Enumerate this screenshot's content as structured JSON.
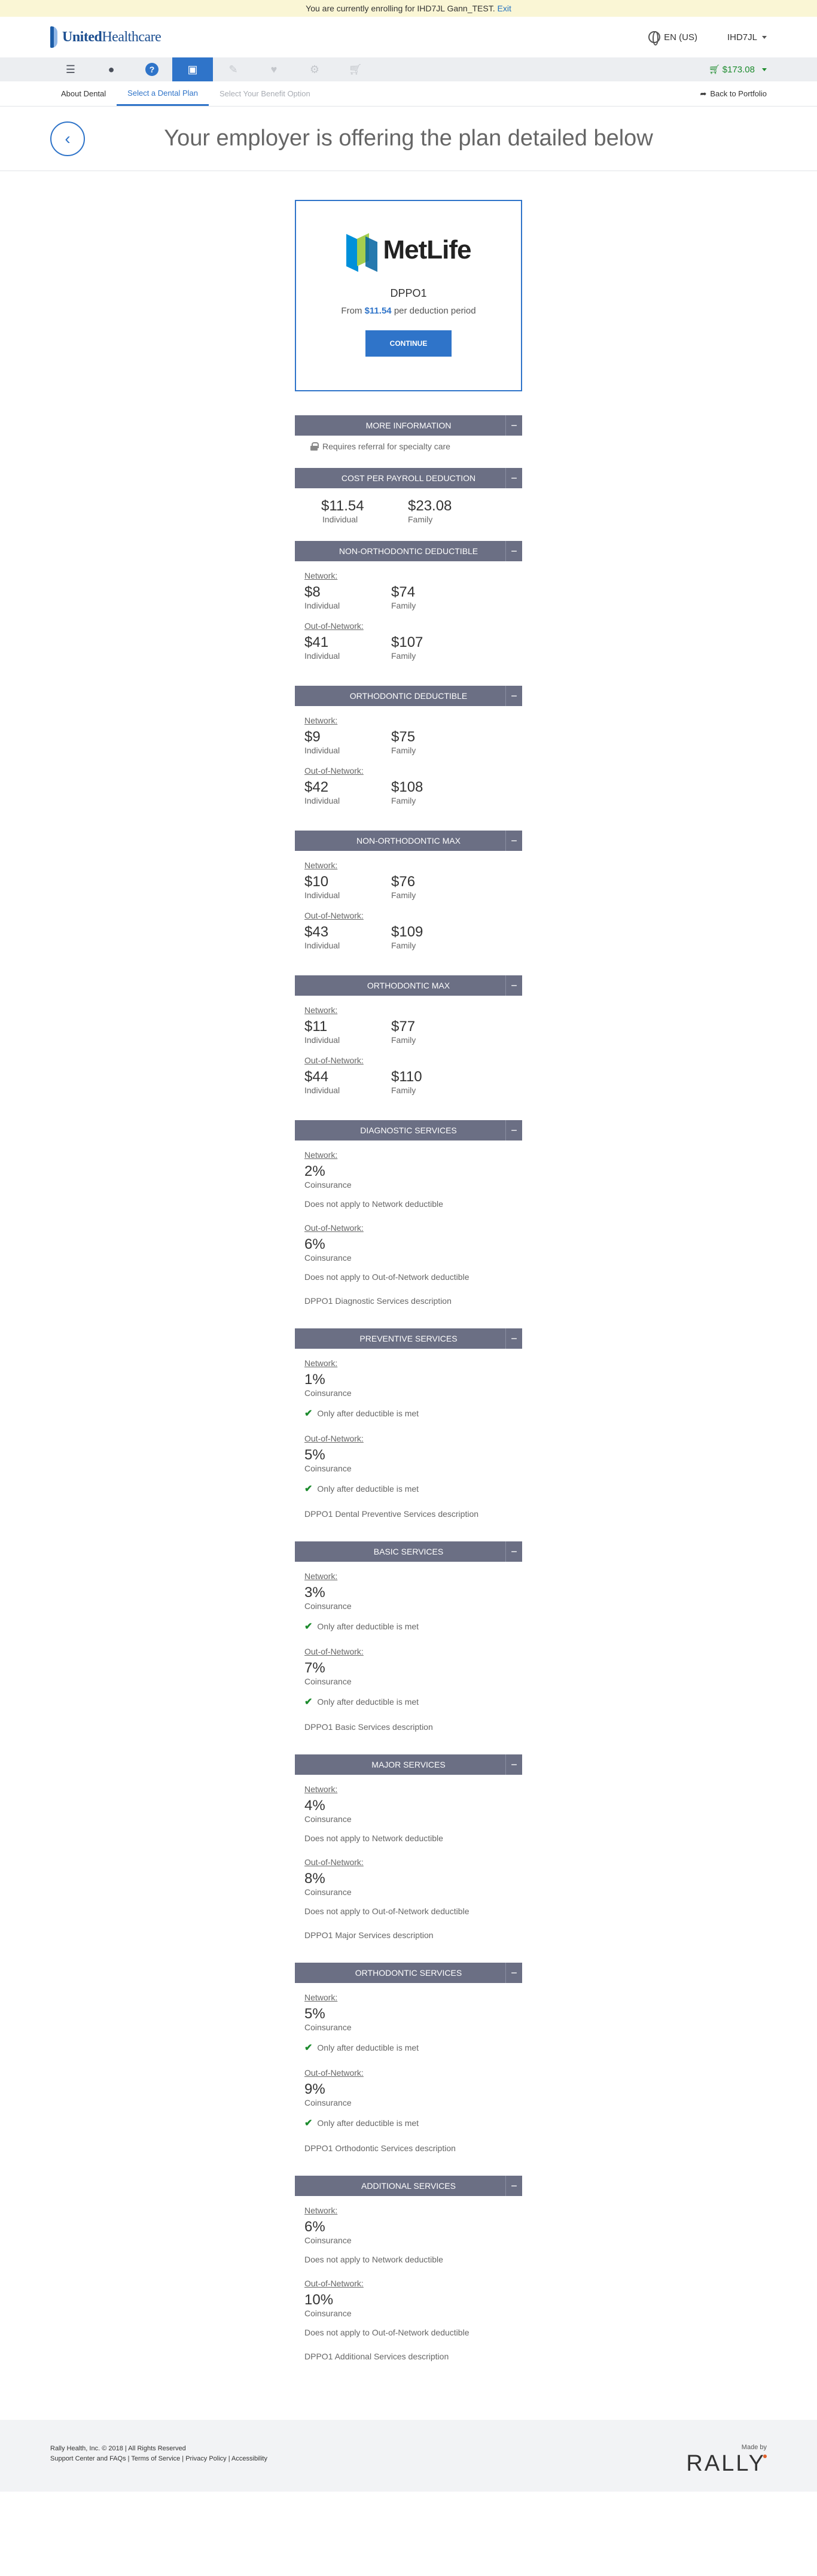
{
  "banner": {
    "text": "You are currently enrolling for IHD7JL Gann_TEST.",
    "exit_label": "Exit"
  },
  "header": {
    "logo_prefix": "United",
    "logo_suffix": "Healthcare",
    "language": "EN (US)",
    "user": "IHD7JL"
  },
  "toolbar": {
    "cart_total": "$173.08"
  },
  "subnav": {
    "tabs": [
      "About Dental",
      "Select a Dental Plan",
      "Select Your Benefit Option"
    ],
    "back_label": "Back to Portfolio"
  },
  "page": {
    "title": "Your employer is offering the plan detailed below"
  },
  "plan": {
    "brand": "MetLife",
    "name": "DPPO1",
    "from_prefix": "From",
    "from_amount": "$11.54",
    "from_suffix": "per deduction period",
    "continue_label": "CONTINUE"
  },
  "labels": {
    "network": "Network:",
    "out_of_network": "Out-of-Network:",
    "individual": "Individual",
    "family": "Family",
    "coinsurance": "Coinsurance"
  },
  "more_info": {
    "title": "MORE INFORMATION",
    "note": "Requires referral for specialty care"
  },
  "payroll": {
    "title": "COST PER PAYROLL DEDUCTION",
    "individual": "$11.54",
    "family": "$23.08"
  },
  "amount_sections": [
    {
      "title": "NON-ORTHODONTIC DEDUCTIBLE",
      "net_ind": "$8",
      "net_fam": "$74",
      "oon_ind": "$41",
      "oon_fam": "$107"
    },
    {
      "title": "ORTHODONTIC DEDUCTIBLE",
      "net_ind": "$9",
      "net_fam": "$75",
      "oon_ind": "$42",
      "oon_fam": "$108"
    },
    {
      "title": "NON-ORTHODONTIC MAX",
      "net_ind": "$10",
      "net_fam": "$76",
      "oon_ind": "$43",
      "oon_fam": "$109"
    },
    {
      "title": "ORTHODONTIC MAX",
      "net_ind": "$11",
      "net_fam": "$77",
      "oon_ind": "$44",
      "oon_fam": "$110"
    }
  ],
  "services": [
    {
      "title": "DIAGNOSTIC SERVICES",
      "net_pct": "2%",
      "net_note": "Does not apply to Network deductible",
      "oon_pct": "6%",
      "oon_note": "Does not apply to Out-of-Network deductible",
      "desc": "DPPO1 Diagnostic Services description"
    },
    {
      "title": "PREVENTIVE SERVICES",
      "net_pct": "1%",
      "net_note": "Only after deductible is met",
      "oon_pct": "5%",
      "oon_note": "Only after deductible is met",
      "desc": "DPPO1 Dental Preventive Services description"
    },
    {
      "title": "BASIC SERVICES",
      "net_pct": "3%",
      "net_note": "Only after deductible is met",
      "oon_pct": "7%",
      "oon_note": "Only after deductible is met",
      "desc": "DPPO1 Basic Services description"
    },
    {
      "title": "MAJOR SERVICES",
      "net_pct": "4%",
      "net_note": "Does not apply to Network deductible",
      "oon_pct": "8%",
      "oon_note": "Does not apply to Out-of-Network deductible",
      "desc": "DPPO1 Major Services description"
    },
    {
      "title": "ORTHODONTIC SERVICES",
      "net_pct": "5%",
      "net_note": "Only after deductible is met",
      "oon_pct": "9%",
      "oon_note": "Only after deductible is met",
      "desc": "DPPO1 Orthodontic Services description"
    },
    {
      "title": "ADDITIONAL SERVICES",
      "net_pct": "6%",
      "net_note": "Does not apply to Network deductible",
      "oon_pct": "10%",
      "oon_note": "Does not apply to Out-of-Network deductible",
      "desc": "DPPO1 Additional Services description"
    }
  ],
  "footer": {
    "copyright": "Rally Health, Inc. © 2018  |  All Rights Reserved",
    "links": "Support Center and FAQs  |  Terms of Service  |  Privacy Policy  |  Accessibility",
    "made_by": "Made by",
    "brand": "RALLY"
  }
}
